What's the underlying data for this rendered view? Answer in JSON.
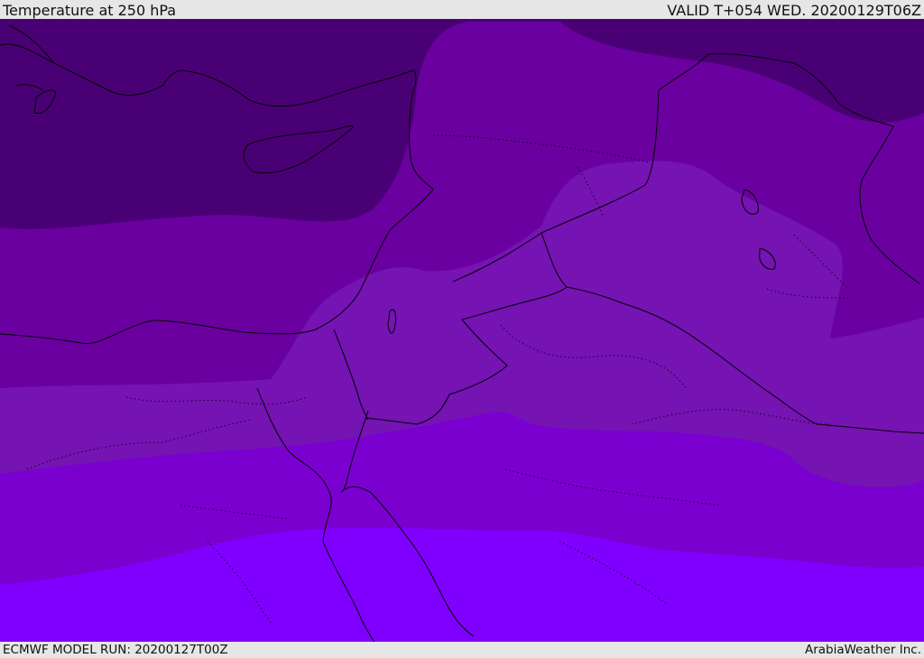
{
  "header": {
    "title": "Temperature at 250 hPa",
    "valid_time": "VALID T+054 WED. 20200129T06Z"
  },
  "footer": {
    "model_run": "ECMWF MODEL RUN: 20200127T00Z",
    "credit": "ArabiaWeather Inc."
  },
  "map": {
    "field": "temperature",
    "level": "250 hPa",
    "shading_colors": [
      "#4a0075",
      "#5b0089",
      "#6a00a0",
      "#7513b3",
      "#7a00d0",
      "#8000ff"
    ],
    "border_color": "#000000"
  }
}
